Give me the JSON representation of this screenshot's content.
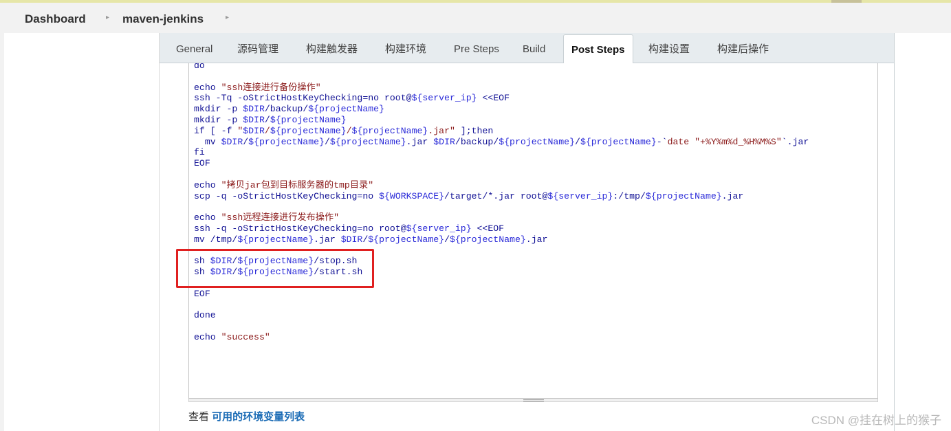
{
  "breadcrumb": {
    "items": [
      "Dashboard",
      "maven-jenkins"
    ]
  },
  "tabs": [
    {
      "label": "General"
    },
    {
      "label": "源码管理"
    },
    {
      "label": "构建触发器"
    },
    {
      "label": "构建环境"
    },
    {
      "label": "Pre Steps"
    },
    {
      "label": "Build"
    },
    {
      "label": "Post Steps",
      "active": true
    },
    {
      "label": "构建设置"
    },
    {
      "label": "构建后操作"
    }
  ],
  "editor": {
    "lines": [
      [
        {
          "t": "do"
        }
      ],
      [
        {
          "t": ""
        }
      ],
      [
        {
          "t": "echo "
        },
        {
          "t": "\"ssh连接进行备份操作\"",
          "c": "str"
        }
      ],
      [
        {
          "t": "ssh -Tq -oStrictHostKeyChecking=no root@"
        },
        {
          "t": "${server_ip}",
          "c": "var"
        },
        {
          "t": " <<EOF"
        }
      ],
      [
        {
          "t": "mkdir -p "
        },
        {
          "t": "$DIR",
          "c": "var"
        },
        {
          "t": "/backup/"
        },
        {
          "t": "${projectName}",
          "c": "var"
        }
      ],
      [
        {
          "t": "mkdir -p "
        },
        {
          "t": "$DIR",
          "c": "var"
        },
        {
          "t": "/"
        },
        {
          "t": "${projectName}",
          "c": "var"
        }
      ],
      [
        {
          "t": "if [ -f "
        },
        {
          "t": "\"",
          "c": "str"
        },
        {
          "t": "$DIR",
          "c": "var"
        },
        {
          "t": "/",
          "c": "str"
        },
        {
          "t": "${projectName}",
          "c": "var"
        },
        {
          "t": "/",
          "c": "str"
        },
        {
          "t": "${projectName}",
          "c": "var"
        },
        {
          "t": ".jar\"",
          "c": "str"
        },
        {
          "t": " ];then"
        }
      ],
      [
        {
          "t": "  mv "
        },
        {
          "t": "$DIR",
          "c": "var"
        },
        {
          "t": "/"
        },
        {
          "t": "${projectName}",
          "c": "var"
        },
        {
          "t": "/"
        },
        {
          "t": "${projectName}",
          "c": "var"
        },
        {
          "t": ".jar "
        },
        {
          "t": "$DIR",
          "c": "var"
        },
        {
          "t": "/backup/"
        },
        {
          "t": "${projectName}",
          "c": "var"
        },
        {
          "t": "/"
        },
        {
          "t": "${projectName}",
          "c": "var"
        },
        {
          "t": "-`"
        },
        {
          "t": "date \"+%Y%m%d_%H%M%S\"",
          "c": "str"
        },
        {
          "t": "`.jar"
        }
      ],
      [
        {
          "t": "fi"
        }
      ],
      [
        {
          "t": "EOF"
        }
      ],
      [
        {
          "t": ""
        }
      ],
      [
        {
          "t": "echo "
        },
        {
          "t": "\"拷贝jar包到目标服务器的tmp目录\"",
          "c": "str"
        }
      ],
      [
        {
          "t": "scp -q -oStrictHostKeyChecking=no "
        },
        {
          "t": "${WORKSPACE}",
          "c": "var"
        },
        {
          "t": "/target/*.jar root@"
        },
        {
          "t": "${server_ip}",
          "c": "var"
        },
        {
          "t": ":/tmp/"
        },
        {
          "t": "${projectName}",
          "c": "var"
        },
        {
          "t": ".jar"
        }
      ],
      [
        {
          "t": ""
        }
      ],
      [
        {
          "t": "echo "
        },
        {
          "t": "\"ssh远程连接进行发布操作\"",
          "c": "str"
        }
      ],
      [
        {
          "t": "ssh -q -oStrictHostKeyChecking=no root@"
        },
        {
          "t": "${server_ip}",
          "c": "var"
        },
        {
          "t": " <<EOF"
        }
      ],
      [
        {
          "t": "mv /tmp/"
        },
        {
          "t": "${projectName}",
          "c": "var"
        },
        {
          "t": ".jar "
        },
        {
          "t": "$DIR",
          "c": "var"
        },
        {
          "t": "/"
        },
        {
          "t": "${projectName}",
          "c": "var"
        },
        {
          "t": "/"
        },
        {
          "t": "${projectName}",
          "c": "var"
        },
        {
          "t": ".jar"
        }
      ],
      [
        {
          "t": ""
        }
      ],
      [
        {
          "t": "sh "
        },
        {
          "t": "$DIR",
          "c": "var"
        },
        {
          "t": "/"
        },
        {
          "t": "${projectName}",
          "c": "var"
        },
        {
          "t": "/stop.sh"
        }
      ],
      [
        {
          "t": "sh "
        },
        {
          "t": "$DIR",
          "c": "var"
        },
        {
          "t": "/"
        },
        {
          "t": "${projectName}",
          "c": "var"
        },
        {
          "t": "/start.sh"
        }
      ],
      [
        {
          "t": ""
        }
      ],
      [
        {
          "t": "EOF"
        }
      ],
      [
        {
          "t": ""
        }
      ],
      [
        {
          "t": "done"
        }
      ],
      [
        {
          "t": ""
        }
      ],
      [
        {
          "t": "echo "
        },
        {
          "t": "\"success\"",
          "c": "str"
        }
      ]
    ]
  },
  "env": {
    "prefix": "查看 ",
    "link": "可用的环境变量列表"
  },
  "watermark": "CSDN @挂在树上的猴子",
  "colors": {
    "highlight": "#e02020",
    "link": "#1a6bb5",
    "code": "#101094",
    "string": "#8b1a1a",
    "variable": "#2a2ad8"
  }
}
